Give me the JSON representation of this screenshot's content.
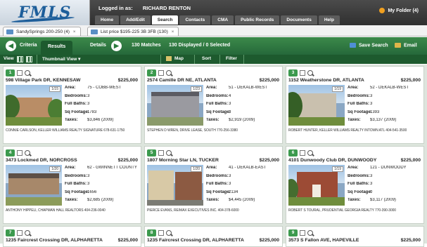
{
  "header": {
    "logo": "FMLS",
    "logged_in_label": "Logged in as:",
    "user_name": "RICHARD RENTON",
    "folder": "My Folder (4)",
    "nav": [
      "Home",
      "Add/Edit",
      "Search",
      "Contacts",
      "CMA",
      "Public Records",
      "Documents",
      "Help"
    ],
    "active_nav": "Search"
  },
  "search_tabs": [
    {
      "label": "SandySprings 200-250 (4)"
    },
    {
      "label": "List price $195-225 3B 3FB (130)"
    }
  ],
  "toolbar": {
    "criteria": "Criteria",
    "results": "Results",
    "details": "Details",
    "matches": "130 Matches",
    "displayed": "130 Displayed / 0 Selected",
    "save_search": "Save Search",
    "email": "Email",
    "accent": "#2a7a3c"
  },
  "viewbar": {
    "view": "View",
    "thumbnail": "Thumbnail View",
    "map": "Map",
    "sort": "Sort",
    "filter": "Filter"
  },
  "labels": {
    "area": "Area:",
    "bedrooms": "Bedrooms:",
    "full_baths": "Full Baths:",
    "sq_footage": "Sq Footage:",
    "taxes": "Taxes:"
  },
  "listings": [
    {
      "num": "1",
      "address": "598 Village Park DR, KENNESAW",
      "price": "$225,000",
      "photo_count": "1/15",
      "area": "75 - COBB-WEST",
      "bedrooms": "3",
      "full_baths": "3",
      "sq_footage": "1783",
      "taxes": "$3,846 (2009)",
      "agent": "CONNIE CARLSON, KELLER WILLIAMS REALTY SIGNATURE 678-631-1750"
    },
    {
      "num": "2",
      "address": "2574 Camille DR NE, ATLANTA",
      "price": "$225,000",
      "photo_count": "1/23",
      "area": "51 - DEKALB-WEST",
      "bedrooms": "4",
      "full_baths": "3",
      "sq_footage": "3",
      "taxes": "$2,919 (2009)",
      "agent": "STEPHEN D WREN, DRIVE LEASE, SOUTH 770-256-3380"
    },
    {
      "num": "3",
      "address": "1152 Weatherstone DR, ATLANTA",
      "price": "$225,000",
      "photo_count": "1/19",
      "area": "52 - DEKALB-WEST",
      "bedrooms": "3",
      "full_baths": "3",
      "sq_footage": "1393",
      "taxes": "$3,137 (2009)",
      "agent": "ROBERT HUNTER, KELLER WILLIAMS REALTY INTOWN ATL 404-541-3500"
    },
    {
      "num": "4",
      "address": "3473 Lockmed DR, NORCROSS",
      "price": "$225,000",
      "photo_count": "1/20",
      "area": "62 - GWINNETT COUNTY",
      "bedrooms": "3",
      "full_baths": "3",
      "sq_footage": "1656",
      "taxes": "$2,685 (2009)",
      "agent": "ANTHONY HIPPELI, CHAPMAN HALL REALTORS 404-236-0040"
    },
    {
      "num": "5",
      "address": "1807 Morning Star LN, TUCKER",
      "price": "$225,000",
      "photo_count": "1/20",
      "area": "41 - DEKALB-EAST",
      "bedrooms": "3",
      "full_baths": "3",
      "sq_footage": "2134",
      "taxes": "$4,445 (2009)",
      "agent": "PIERCE EVANS, RE/MAX EXECUTIVES INC. 404-378-6000"
    },
    {
      "num": "6",
      "address": "4101 Dunwoody Club DR, DUNWOODY",
      "price": "$225,000",
      "photo_count": "1/19",
      "area": "121 - DUNWOODY",
      "bedrooms": "3",
      "full_baths": "3",
      "sq_footage": "0",
      "taxes": "$3,117 (2009)",
      "agent": "ROBERT S TOURAL, PRUDENTIAL GEORGIA REALTY 770-390-3000"
    },
    {
      "num": "7",
      "address": "1235 Faircrest Crossing DR, ALPHARETTA",
      "price": "$225,000"
    },
    {
      "num": "8",
      "address": "1235 Faircrest Crossing DR, ALPHARETTA",
      "price": "$225,000"
    },
    {
      "num": "9",
      "address": "3573 S Fallon AVE, HAPEVILLE",
      "price": "$225,000"
    }
  ]
}
